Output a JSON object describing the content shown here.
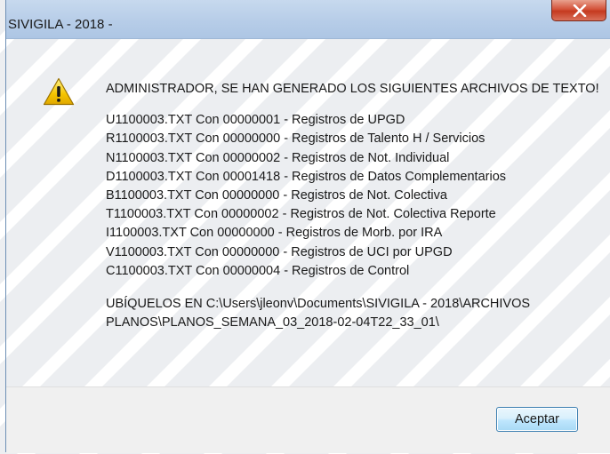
{
  "window": {
    "title": "SIVIGILA - 2018 -",
    "close_icon": "close-x-icon"
  },
  "message": {
    "icon": "warning-icon",
    "heading": "ADMINISTRADOR, SE HAN GENERADO LOS SIGUIENTES ARCHIVOS DE TEXTO!",
    "files": [
      "U1100003.TXT Con 00000001 - Registros de UPGD",
      "R1100003.TXT Con 00000000 - Registros de Talento H / Servicios",
      "N1100003.TXT Con 00000002 - Registros de Not. Individual",
      "D1100003.TXT Con 00001418 - Registros de Datos Complementarios",
      "B1100003.TXT Con 00000000 - Registros de Not. Colectiva",
      "T1100003.TXT Con 00000002 - Registros de Not. Colectiva Reporte",
      "I1100003.TXT Con 00000000 - Registros de Morb. por IRA",
      "V1100003.TXT Con 00000000 - Registros de UCI por UPGD",
      "C1100003.TXT Con 00000004 - Registros de Control"
    ],
    "location": "UBÍQUELOS EN C:\\Users\\jleonv\\Documents\\SIVIGILA - 2018\\ARCHIVOS PLANOS\\PLANOS_SEMANA_03_2018-02-04T22_33_01\\"
  },
  "buttons": {
    "ok_label": "Aceptar"
  },
  "colors": {
    "titlebar": "#b7cde8",
    "close_button": "#c53a1f",
    "warning_yellow": "#f5c400",
    "footer": "#f0f0f0"
  }
}
